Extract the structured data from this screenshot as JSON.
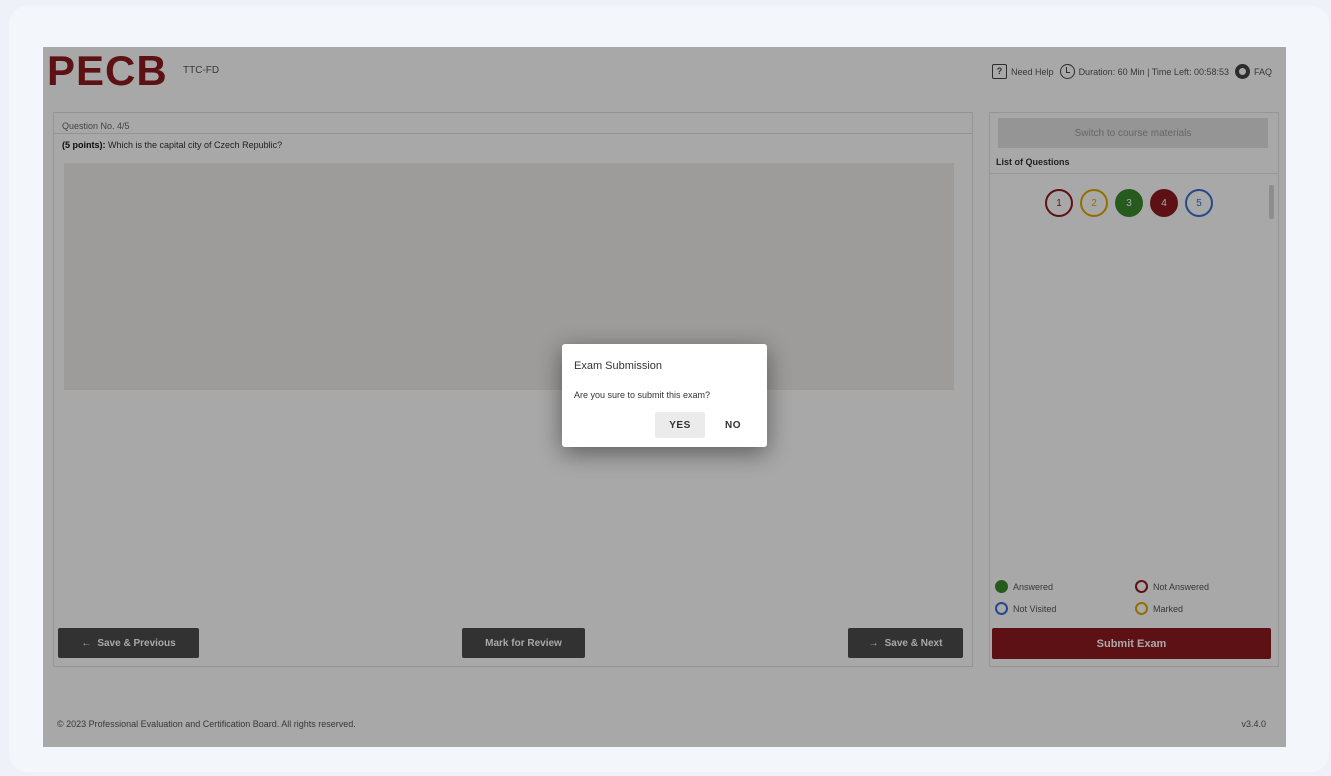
{
  "header": {
    "logo": "PECB",
    "exam_code": "TTC-FD",
    "help_label": "Need Help",
    "duration_label": "Duration: 60 Min | Time Left: 00:58:53",
    "faq_label": "FAQ"
  },
  "question": {
    "number": "Question No. 4/5",
    "points": "(5 points):",
    "text": "Which is the capital city of Czech Republic?"
  },
  "nav": {
    "prev_label": "Save & Previous",
    "review_label": "Mark for Review",
    "next_label": "Save & Next"
  },
  "sidebar": {
    "switch_label": "Switch to course materials",
    "list_title": "List of Questions",
    "questions": [
      "1",
      "2",
      "3",
      "4",
      "5"
    ],
    "legend": {
      "answered": "Answered",
      "not_answered": "Not Answered",
      "not_visited": "Not Visited",
      "marked": "Marked"
    },
    "submit_label": "Submit Exam"
  },
  "footer": {
    "copyright": "© 2023 Professional Evaluation and Certification Board. All rights reserved.",
    "version": "v3.4.0"
  },
  "dialog": {
    "title": "Exam Submission",
    "message": "Are you sure to submit this exam?",
    "yes_label": "YES",
    "no_label": "NO"
  },
  "colors": {
    "brand": "#8e1b1f",
    "answered": "#3c8a2e",
    "not_answered": "#8e1b1f",
    "not_visited": "#3b6fd1",
    "marked": "#e0a800"
  }
}
